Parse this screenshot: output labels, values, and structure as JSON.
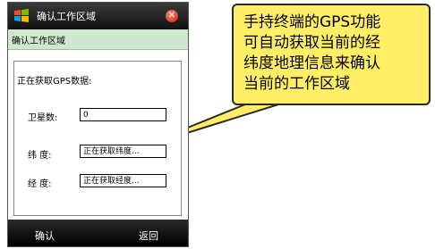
{
  "window": {
    "title": "确认工作区域",
    "close_glyph": "✕"
  },
  "section": {
    "heading": "确认工作区域"
  },
  "form": {
    "status": "正在获取GPS数据:",
    "satellites": {
      "label": "卫星数:",
      "value": "0"
    },
    "latitude": {
      "label": "纬  度:",
      "value": "正在获取纬度..."
    },
    "longitude": {
      "label": "经  度:",
      "value": "正在获取经度..."
    }
  },
  "softkeys": {
    "left": "确认",
    "right": "返回"
  },
  "callout": {
    "lines": [
      "手持终端的GPS功能",
      "可自动获取当前的经",
      "纬度地理信息来确认",
      "当前的工作区域"
    ]
  },
  "icons": {
    "logo": "windows-logo-icon",
    "close": "close-icon"
  },
  "colors": {
    "callout_fill": "#ffee66",
    "section_bg": "#cfe6cf",
    "close_red": "#c0200a"
  }
}
